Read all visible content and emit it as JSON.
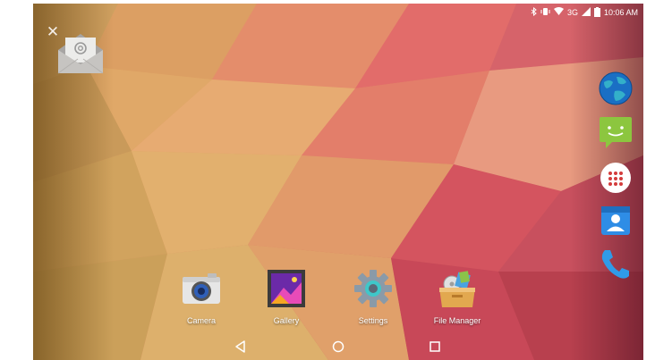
{
  "status_bar": {
    "network": "3G",
    "time": "10:06 AM",
    "icons": [
      "bluetooth-icon",
      "vibrate-icon",
      "wifi-icon",
      "signal-icon",
      "battery-icon"
    ]
  },
  "widget": {
    "icon": "email-icon",
    "close_icon": "close-icon"
  },
  "right_dock": [
    {
      "icon": "browser-globe-icon"
    },
    {
      "icon": "messaging-icon"
    },
    {
      "icon": "app-drawer-icon"
    },
    {
      "icon": "contacts-icon"
    },
    {
      "icon": "phone-icon"
    }
  ],
  "apps": [
    {
      "label": "Camera",
      "icon": "camera-icon"
    },
    {
      "label": "Gallery",
      "icon": "gallery-icon"
    },
    {
      "label": "Settings",
      "icon": "settings-icon"
    },
    {
      "label": "File Manager",
      "icon": "file-manager-icon"
    }
  ],
  "nav_bar": {
    "buttons": [
      "back-icon",
      "home-icon",
      "recents-icon"
    ]
  },
  "colors": {
    "wallpaper_gold": "#d8a55c",
    "wallpaper_coral": "#e07f66",
    "wallpaper_rose": "#d45c63",
    "wallpaper_deep": "#b3404d"
  }
}
